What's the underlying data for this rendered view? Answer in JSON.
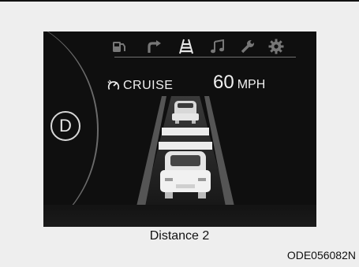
{
  "display": {
    "gear_indicator": "D",
    "icon_tabs": [
      {
        "name": "fuel-trip-icon"
      },
      {
        "name": "navigation-arrow-icon"
      },
      {
        "name": "driving-assist-lane-icon",
        "active": true
      },
      {
        "name": "music-note-icon"
      },
      {
        "name": "wrench-icon"
      },
      {
        "name": "gear-settings-icon"
      }
    ],
    "cruise": {
      "label": "CRUISE",
      "speed_value": "60",
      "speed_unit": "MPH"
    },
    "following_distance": {
      "level": 2
    }
  },
  "caption": "Distance 2",
  "figure_code": "ODE056082N",
  "colors": {
    "screen_bg": "#0f0f0f",
    "text": "#f0f0f0",
    "icon_inactive": "#777777",
    "page_bg": "#eeeeee"
  }
}
